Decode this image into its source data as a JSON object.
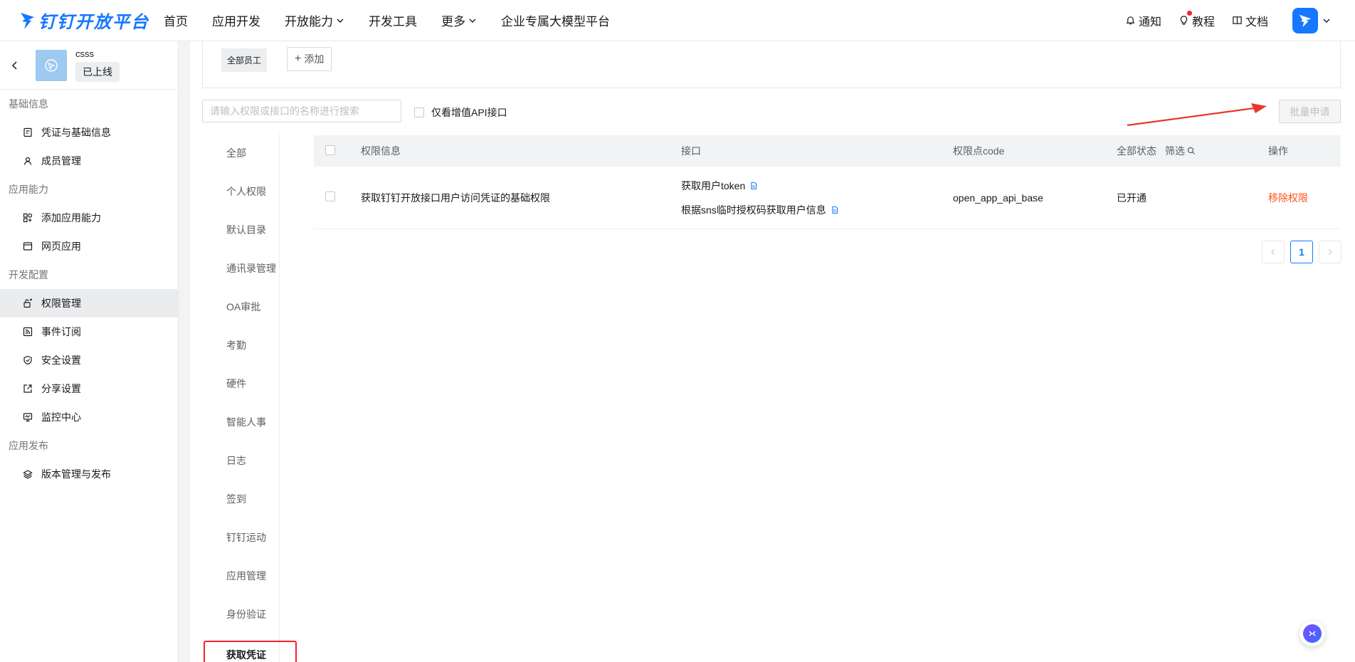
{
  "brand": {
    "logo_text": "钉钉开放平台",
    "accent": "#1677ff"
  },
  "topnav": {
    "items": [
      {
        "label": "首页"
      },
      {
        "label": "应用开发"
      },
      {
        "label": "开放能力"
      },
      {
        "label": "开发工具"
      },
      {
        "label": "更多"
      },
      {
        "label": "企业专属大模型平台"
      }
    ],
    "right": {
      "notify": "通知",
      "tutorial": "教程",
      "docs": "文档"
    }
  },
  "sidebar": {
    "app_name": "csss",
    "app_status": "已上线",
    "groups": [
      {
        "title": "基础信息",
        "items": [
          {
            "label": "凭证与基础信息"
          },
          {
            "label": "成员管理"
          }
        ]
      },
      {
        "title": "应用能力",
        "items": [
          {
            "label": "添加应用能力"
          },
          {
            "label": "网页应用"
          }
        ]
      },
      {
        "title": "开发配置",
        "items": [
          {
            "label": "权限管理"
          },
          {
            "label": "事件订阅"
          },
          {
            "label": "安全设置"
          },
          {
            "label": "分享设置"
          },
          {
            "label": "监控中心"
          }
        ]
      },
      {
        "title": "应用发布",
        "items": [
          {
            "label": "版本管理与发布"
          }
        ]
      }
    ],
    "active": "权限管理"
  },
  "scope": {
    "tag": "全部员工",
    "add_label": "添加"
  },
  "filters": {
    "search_placeholder": "请输入权限或接口的名称进行搜索",
    "value_added_only": "仅看增值API接口",
    "batch_apply": "批量申请"
  },
  "categories": [
    "全部",
    "个人权限",
    "默认目录",
    "通讯录管理",
    "OA审批",
    "考勤",
    "硬件",
    "智能人事",
    "日志",
    "签到",
    "钉钉运动",
    "应用管理",
    "身份验证",
    "获取凭证"
  ],
  "active_category": "获取凭证",
  "table": {
    "headers": {
      "info": "权限信息",
      "api": "接口",
      "code": "权限点code",
      "status": "全部状态",
      "filter": "筛选",
      "op": "操作"
    },
    "rows": [
      {
        "info": "获取钉钉开放接口用户访问凭证的基础权限",
        "apis": [
          "获取用户token",
          "根据sns临时授权码获取用户信息"
        ],
        "code": "open_app_api_base",
        "status": "已开通",
        "op": "移除权限"
      }
    ]
  },
  "pagination": {
    "current": "1"
  },
  "colors": {
    "danger": "#ff5219",
    "highlight_border": "#f5222d",
    "arrow": "#e8372c"
  }
}
